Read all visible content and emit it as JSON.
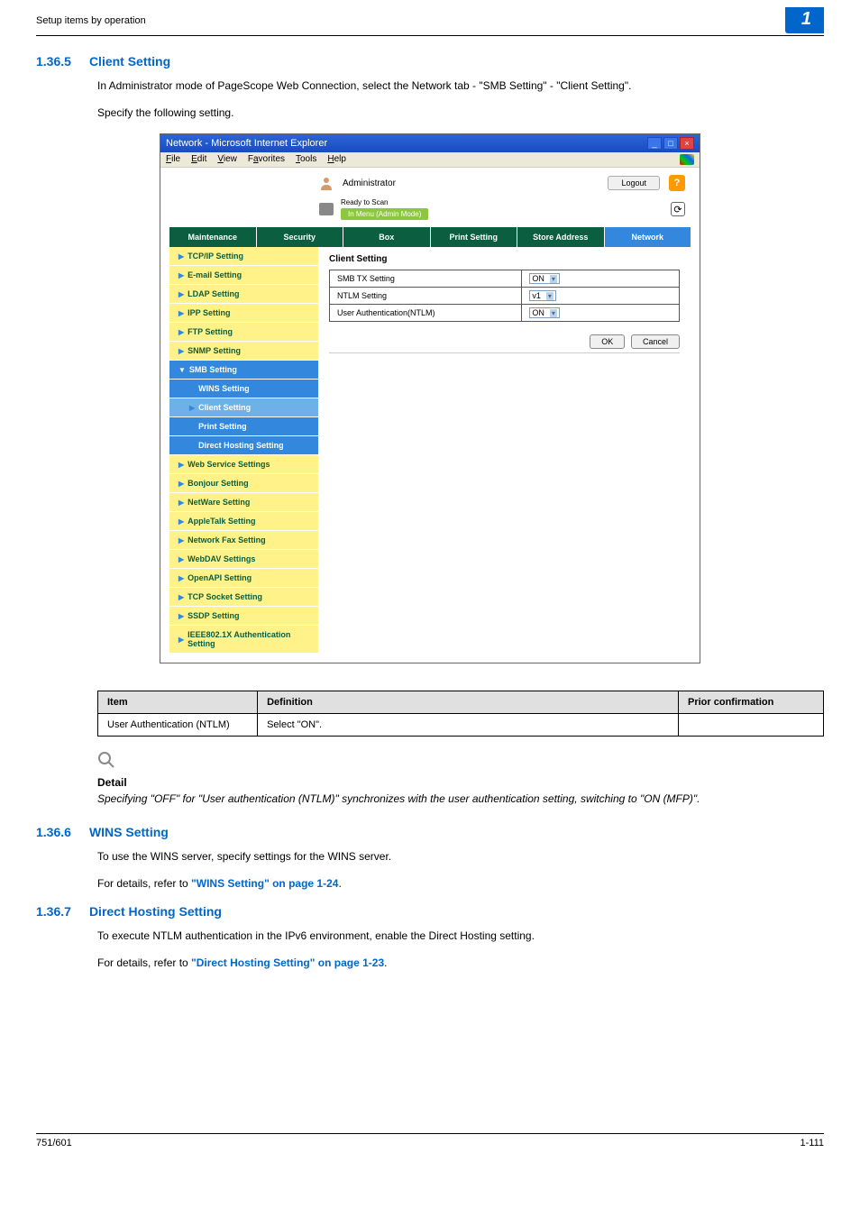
{
  "header": {
    "breadcrumb": "Setup items by operation",
    "chapter": "1"
  },
  "s1": {
    "num": "1.36.5",
    "title": "Client Setting",
    "para1": "In Administrator mode of PageScope Web Connection, select the Network tab - \"SMB Setting\" - \"Client Setting\".",
    "para2": "Specify the following setting."
  },
  "browser": {
    "title": "Network - Microsoft Internet Explorer",
    "menu": {
      "file": "File",
      "edit": "Edit",
      "view": "View",
      "favorites": "Favorites",
      "tools": "Tools",
      "help": "Help"
    },
    "admin": "Administrator",
    "logout": "Logout",
    "ready": "Ready to Scan",
    "mode": "In Menu (Admin Mode)",
    "help": "?",
    "tabs": {
      "maintenance": "Maintenance",
      "security": "Security",
      "box": "Box",
      "print": "Print Setting",
      "store": "Store Address",
      "network": "Network"
    },
    "sidebar": {
      "tcpip": "TCP/IP Setting",
      "email": "E-mail Setting",
      "ldap": "LDAP Setting",
      "ipp": "IPP Setting",
      "ftp": "FTP Setting",
      "snmp": "SNMP Setting",
      "smb": "SMB Setting",
      "wins": "WINS Setting",
      "client": "Client Setting",
      "print": "Print Setting",
      "direct": "Direct Hosting Setting",
      "web": "Web Service Settings",
      "bonjour": "Bonjour Setting",
      "netware": "NetWare Setting",
      "appletalk": "AppleTalk Setting",
      "netfax": "Network Fax Setting",
      "webdav": "WebDAV Settings",
      "openapi": "OpenAPI Setting",
      "tcpsocket": "TCP Socket Setting",
      "ssdp": "SSDP Setting",
      "ieee": "IEEE802.1X Authentication Setting"
    },
    "content": {
      "title": "Client Setting",
      "row1": {
        "label": "SMB TX Setting",
        "value": "ON"
      },
      "row2": {
        "label": "NTLM Setting",
        "value": "v1"
      },
      "row3": {
        "label": "User Authentication(NTLM)",
        "value": "ON"
      },
      "ok": "OK",
      "cancel": "Cancel"
    }
  },
  "table": {
    "h1": "Item",
    "h2": "Definition",
    "h3": "Prior confirmation",
    "r1c1": "User Authentication (NTLM)",
    "r1c2": "Select \"ON\".",
    "r1c3": ""
  },
  "detail": {
    "label": "Detail",
    "text": "Specifying \"OFF\" for \"User authentication (NTLM)\" synchronizes with the user authentication setting, switching to \"ON (MFP)\"."
  },
  "s2": {
    "num": "1.36.6",
    "title": "WINS Setting",
    "para1": "To use the WINS server, specify settings for the WINS server.",
    "para2a": "For details, refer to ",
    "link": "\"WINS Setting\" on page 1-24",
    "para2b": "."
  },
  "s3": {
    "num": "1.36.7",
    "title": "Direct Hosting Setting",
    "para1": "To execute NTLM authentication in the IPv6 environment, enable the Direct Hosting setting.",
    "para2a": "For details, refer to ",
    "link": "\"Direct Hosting Setting\" on page 1-23",
    "para2b": "."
  },
  "footer": {
    "left": "751/601",
    "right": "1-111"
  }
}
